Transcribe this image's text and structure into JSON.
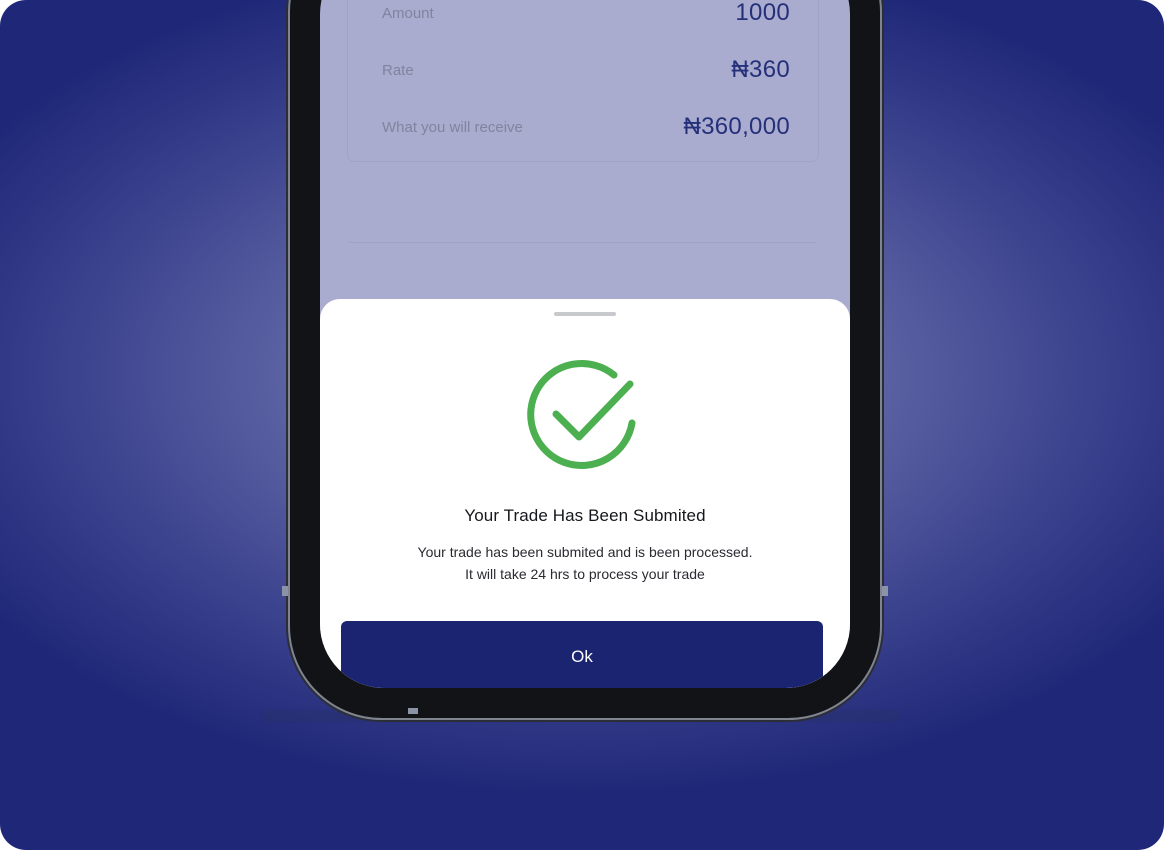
{
  "summary": {
    "rows": [
      {
        "label": "Amount",
        "value": "1000"
      },
      {
        "label": "Rate",
        "value": "₦360"
      },
      {
        "label": "What you will receive",
        "value": "₦360,000"
      }
    ]
  },
  "sheet": {
    "title": "Your Trade Has Been Submited",
    "message_line1": "Your trade has been submited and is been processed.",
    "message_line2": "It will take 24 hrs to process your trade",
    "ok_label": "Ok",
    "icon": "check-circle-icon"
  },
  "colors": {
    "background": "#3a418d",
    "accent": "#1a2471",
    "success": "#4caf50",
    "value_text": "#25307a"
  }
}
